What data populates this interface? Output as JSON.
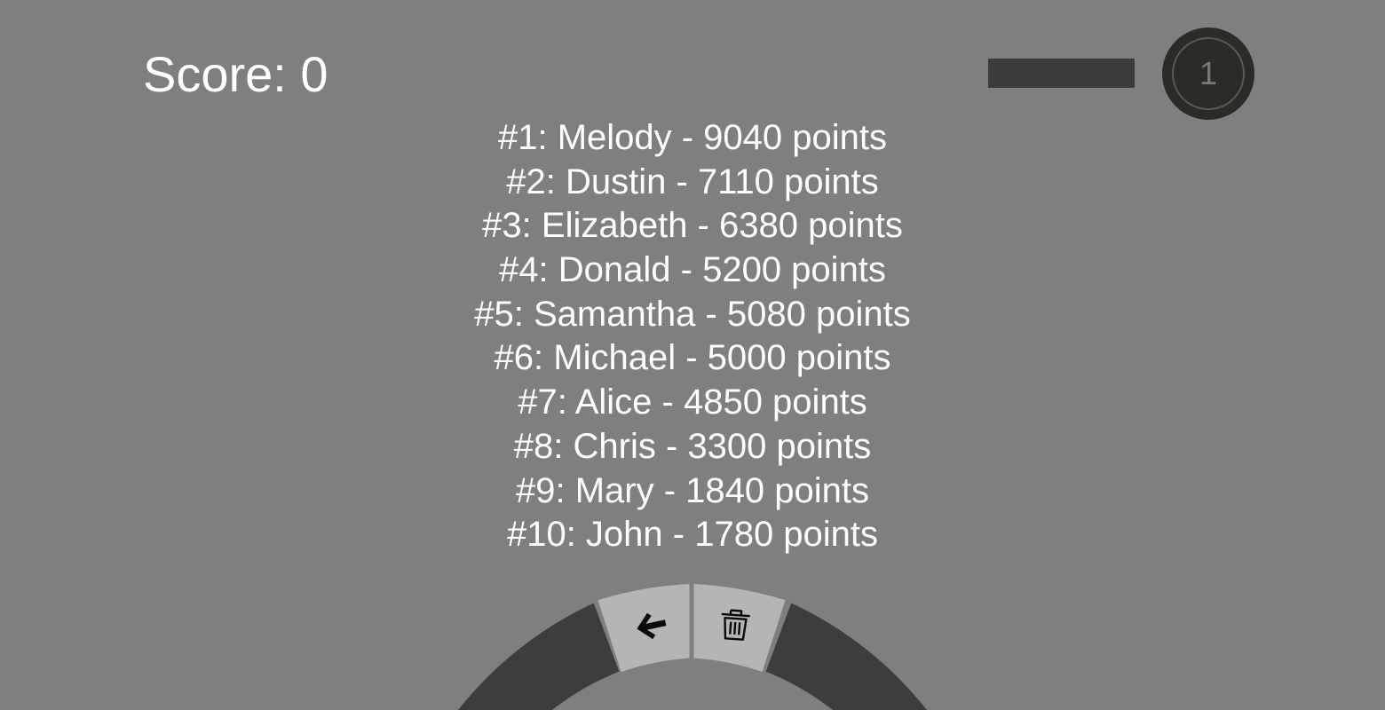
{
  "hud": {
    "score_text": "Score: 0",
    "progress_fraction": 0,
    "level": "1"
  },
  "leaderboard": [
    "#1: Melody - 9040 points",
    "#2: Dustin - 7110 points",
    "#3: Elizabeth - 6380 points",
    "#4: Donald - 5200 points",
    "#5: Samantha - 5080 points",
    "#6: Michael - 5000 points",
    "#7: Alice - 4850 points",
    "#8: Chris - 3300 points",
    "#9: Mary - 1840 points",
    "#10: John - 1780 points"
  ],
  "menu": {
    "back_icon": "back-arrow-icon",
    "delete_icon": "trash-icon"
  },
  "colors": {
    "background": "#7f7f7f",
    "text": "#ffffff",
    "wheel_dark": "#3d3d3d",
    "wheel_button": "#b5b5b5",
    "badge": "#2b2b27",
    "progress_track": "#3c3c3c"
  }
}
